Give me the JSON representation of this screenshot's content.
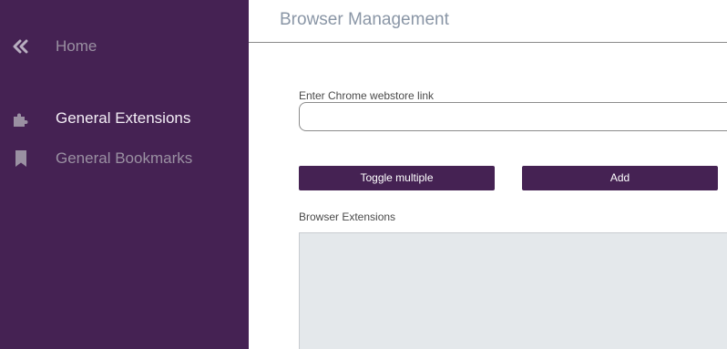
{
  "sidebar": {
    "items": [
      {
        "label": "Home",
        "icon": "double-chevron-left-icon"
      },
      {
        "label": "General Extensions",
        "icon": "puzzle-icon"
      },
      {
        "label": "General Bookmarks",
        "icon": "bookmark-icon"
      }
    ],
    "background_color": "#452253"
  },
  "header": {
    "title": "Browser Management"
  },
  "form": {
    "link_label": "Enter Chrome webstore link",
    "link_value": "",
    "link_placeholder": ""
  },
  "buttons": {
    "toggle_label": "Toggle multiple",
    "add_label": "Add"
  },
  "extensions": {
    "label": "Browser Extensions",
    "items": []
  }
}
